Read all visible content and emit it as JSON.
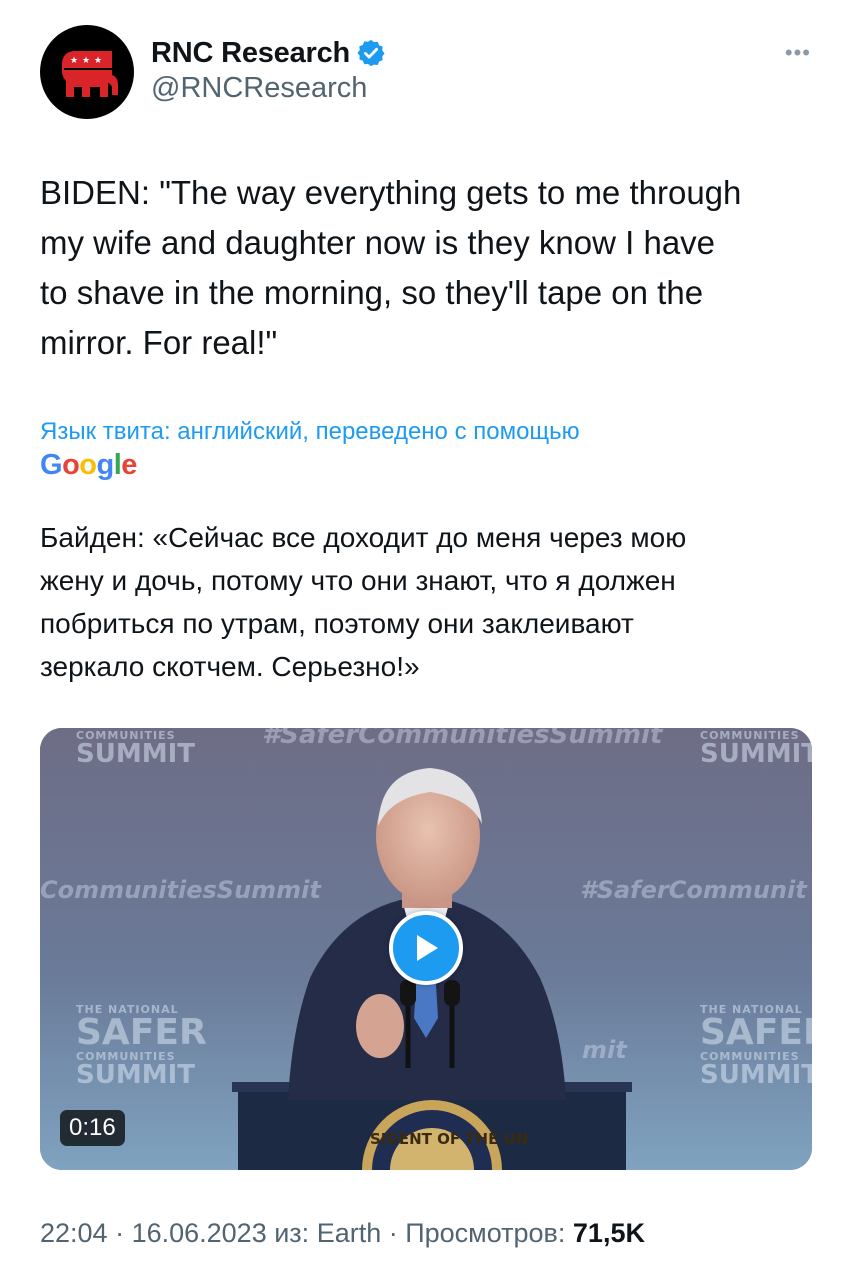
{
  "account": {
    "display_name": "RNC Research",
    "handle": "@RNCResearch",
    "verified": true,
    "avatar_icon": "republican-elephant-icon"
  },
  "more_label": "•••",
  "tweet": {
    "text": "BIDEN: \"The way everything gets to me through\nmy wife and daughter now is they know I have\nto shave in the morning, so they'll tape on the\nmirror. For real!\""
  },
  "translation": {
    "label": "Язык твита: английский, переведено с помощью",
    "provider": {
      "G": "G",
      "o1": "o",
      "o2": "o",
      "g": "g",
      "l": "l",
      "e": "e"
    },
    "text": "Байден: «Сейчас все доходит до меня через мою\nжену и дочь, потому что они знают, что я должен\nпобриться по утрам, поэтому они заклеивают\nзеркало скотчем. Серьезно!»"
  },
  "media": {
    "duration": "0:16",
    "banner": {
      "top_hashtag": "#SaferCommunitiesSummit",
      "left_hashtag": "CommunitiesSummit",
      "right_hashtag": "#SaferCommunit",
      "center_fragment": "mit",
      "summit_top_left_small": "COMMUNITIES",
      "summit_top_left": "SUMMIT",
      "summit_top_right_small": "COMMUNITIES",
      "summit_top_right": "SUMMIT",
      "safer_left": "SAFER",
      "safer_left_small": "COMMUNITIES",
      "safer_left_bottom": "SUMMIT",
      "safer_right_tiny": "THE NATIONAL",
      "safer_right": "SAFER",
      "safer_right_small": "COMMUNITIES",
      "safer_right_bottom": "SUMMIT",
      "safer_left_tiny": "THE NATIONAL",
      "seal_text": "SIDENT OF THE UN"
    }
  },
  "footer": {
    "time": "22:04",
    "sep1": " · ",
    "date": "16.06.2023",
    "source_prefix": " из: ",
    "source": "Earth",
    "sep2": " · ",
    "views_label": "Просмотров: ",
    "views_count": "71,5K"
  },
  "colors": {
    "accent": "#1d9bf0",
    "text": "#0f1419",
    "secondary": "#536471"
  }
}
